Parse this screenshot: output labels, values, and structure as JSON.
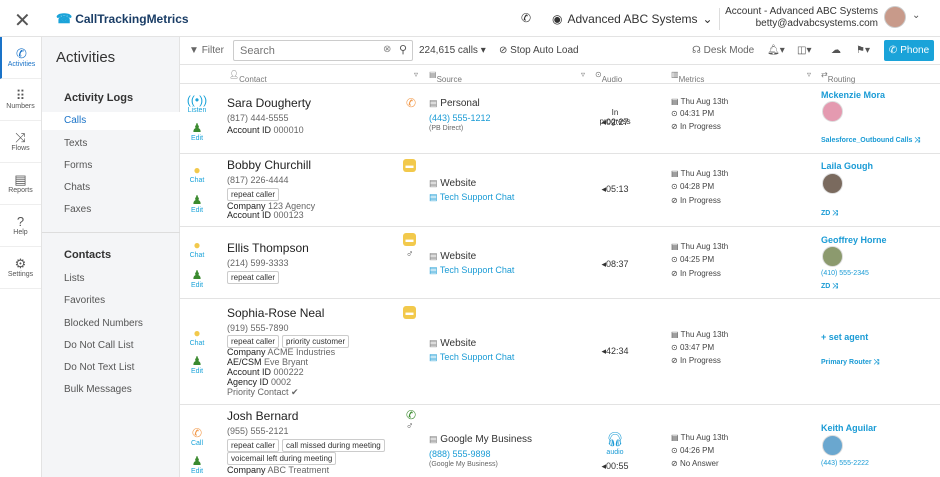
{
  "app": {
    "logo_text": "CallTrackingMetrics",
    "org_name": "Advanced ABC Systems",
    "account_line1": "Account - Advanced ABC Systems",
    "account_line2": "betty@advabcsystems.com"
  },
  "rail": [
    {
      "label": "Activities",
      "icon": "phone-wave-icon"
    },
    {
      "label": "Numbers",
      "icon": "grid-icon"
    },
    {
      "label": "Flows",
      "icon": "shuffle-icon"
    },
    {
      "label": "Reports",
      "icon": "chart-icon"
    },
    {
      "label": "Help",
      "icon": "help-icon"
    },
    {
      "label": "Settings",
      "icon": "gear-icon"
    }
  ],
  "sidebar": {
    "title": "Activities",
    "logs_header": "Activity Logs",
    "logs": [
      "Calls",
      "Texts",
      "Forms",
      "Chats",
      "Faxes"
    ],
    "contacts_header": "Contacts",
    "contacts": [
      "Lists",
      "Favorites",
      "Blocked Numbers",
      "Do Not Call List",
      "Do Not Text List",
      "Bulk Messages"
    ]
  },
  "toolbar": {
    "filter_label": "Filter",
    "search_placeholder": "Search",
    "calls_count": "224,615 calls",
    "stop_label": "Stop Auto Load",
    "desk_label": "Desk Mode",
    "phone_label": "Phone"
  },
  "columns": {
    "contact": "Contact",
    "source": "Source",
    "audio": "Audio",
    "metrics": "Metrics",
    "routing": "Routing"
  },
  "rows": [
    {
      "action": "Listen",
      "edit": "Edit",
      "name": "Sara Dougherty",
      "phone": "(817) 444-5555",
      "account_label": "Account ID",
      "account_id": "000010",
      "source": "Personal",
      "source_link": "(443) 555-1212",
      "source_sub": "(PB Direct)",
      "audio_status": "In progress",
      "audio_time": "02:27",
      "date": "Thu Aug 13th",
      "time": "04:31 PM",
      "status": "In Progress",
      "agent": "Mckenzie Mora",
      "route": "Salesforce_Outbound Calls"
    },
    {
      "action": "Chat",
      "edit": "Edit",
      "name": "Bobby Churchill",
      "phone": "(817) 226-4444",
      "tags": [
        "repeat caller"
      ],
      "company_label": "Company",
      "company": "123 Agency",
      "account_label": "Account ID",
      "account_id": "000123",
      "source": "Website",
      "source_link": "Tech Support Chat",
      "audio_time": "05:13",
      "date": "Thu Aug 13th",
      "time": "04:28 PM",
      "status": "In Progress",
      "agent": "Laila Gough",
      "route": "ZD"
    },
    {
      "action": "Chat",
      "edit": "Edit",
      "name": "Ellis Thompson",
      "phone": "(214) 599-3333",
      "tags": [
        "repeat caller"
      ],
      "source": "Website",
      "source_link": "Tech Support Chat",
      "audio_time": "08:37",
      "date": "Thu Aug 13th",
      "time": "04:25 PM",
      "status": "In Progress",
      "agent": "Geoffrey Horne",
      "route_phone": "(410) 555-2345",
      "route": "ZD"
    },
    {
      "action": "Chat",
      "edit": "Edit",
      "name": "Sophia-Rose Neal",
      "phone": "(919) 555-7890",
      "tags": [
        "repeat caller",
        "priority customer"
      ],
      "company_label": "Company",
      "company": "ACME Industries",
      "csm_label": "AE/CSM",
      "csm": "Eve Bryant",
      "account_label": "Account ID",
      "account_id": "000222",
      "agency_label": "Agency ID",
      "agency_id": "0002",
      "priority": "Priority Contact",
      "source": "Website",
      "source_link": "Tech Support Chat",
      "audio_time": "42:34",
      "date": "Thu Aug 13th",
      "time": "03:47 PM",
      "status": "In Progress",
      "agent": "+ set agent",
      "route": "Primary Router"
    },
    {
      "action": "Call",
      "edit": "Edit",
      "name": "Josh Bernard",
      "phone": "(955) 555-2121",
      "tags": [
        "repeat caller",
        "call missed during meeting"
      ],
      "tags2": [
        "voicemail left during meeting"
      ],
      "company_label": "Company",
      "company": "ABC Treatment",
      "source": "Google My Business",
      "source_link": "(888) 555-9898",
      "source_sub": "(Google My Business)",
      "audio_label": "audio",
      "audio_time": "00:55",
      "date": "Thu Aug 13th",
      "time": "04:26 PM",
      "status": "No Answer",
      "agent": "Keith Aguilar",
      "route_phone": "(443) 555-2222"
    }
  ],
  "colors": {
    "accent": "#1aa3d9",
    "link": "#1a9bd5",
    "edit_icon": "#3a8a2e",
    "chat_badge": "#f2c94c",
    "call_icon": "#f2994a"
  }
}
